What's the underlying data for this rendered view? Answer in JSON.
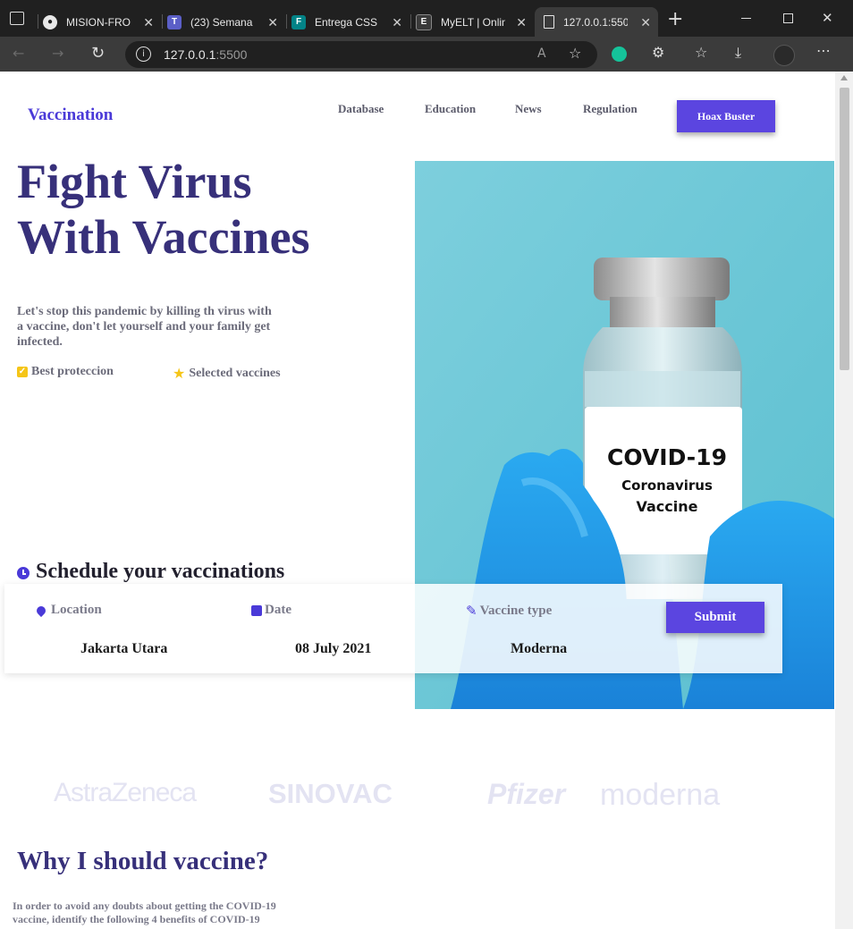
{
  "browser": {
    "tabs": [
      {
        "title": "MISION-FRON",
        "icon": "github-icon"
      },
      {
        "title": "(23) Semana",
        "icon": "teams-icon"
      },
      {
        "title": "Entrega CSS L",
        "icon": "forms-icon"
      },
      {
        "title": "MyELT | Onlin",
        "icon": "myelt-icon"
      },
      {
        "title": "127.0.0.1:550",
        "icon": "page-icon"
      }
    ],
    "url_host": "127.0.0.1",
    "url_port": ":5500",
    "new_tab_glyph": "+",
    "close_glyph": "✕"
  },
  "nav": {
    "brand": "Vaccination",
    "links": [
      "Database",
      "Education",
      "News",
      "Regulation"
    ],
    "cta": "Hoax Buster"
  },
  "hero": {
    "title_line1": "Fight Virus",
    "title_line2": "With Vaccines",
    "subtitle": "Let's stop this pandemic by killing th virus with a vaccine, don't let yourself and your family get infected.",
    "features": [
      "Best proteccion",
      "Selected vaccines"
    ]
  },
  "image": {
    "label_title": "COVID-19",
    "label_line2": "Coronavirus",
    "label_line3": "Vaccine"
  },
  "schedule": {
    "title": "Schedule your vaccinations",
    "fields": [
      {
        "label": "Location",
        "value": "Jakarta Utara"
      },
      {
        "label": "Date",
        "value": "08 July 2021"
      },
      {
        "label": "Vaccine type",
        "value": "Moderna"
      }
    ],
    "submit": "Submit"
  },
  "partners": [
    "AstraZeneca",
    "SINOVAC",
    "Pfizer",
    "moderna"
  ],
  "why": {
    "title": "Why I should vaccine?",
    "text": "In order to avoid any doubts about getting the COVID-19 vaccine, identify the following 4 benefits of COVID-19"
  },
  "colors": {
    "accent": "#5b45e0",
    "heading": "#37307a",
    "brand": "#4a3ad8"
  }
}
